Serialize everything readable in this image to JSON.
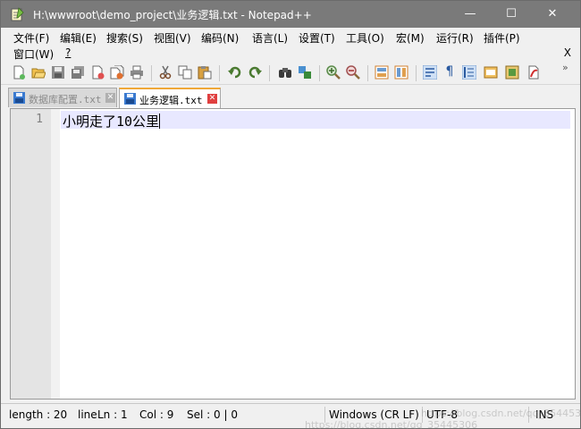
{
  "window": {
    "title": "H:\\wwwroot\\demo_project\\业务逻辑.txt - Notepad++",
    "minimize": "—",
    "maximize": "☐",
    "close": "✕"
  },
  "menu": {
    "items": [
      "文件(F)",
      "编辑(E)",
      "搜索(S)",
      "视图(V)",
      "编码(N)",
      "语言(L)",
      "设置(T)",
      "工具(O)",
      "宏(M)",
      "运行(R)",
      "插件(P)"
    ],
    "row2": [
      "窗口(W)",
      "?"
    ],
    "close_doc": "X"
  },
  "toolbar": {
    "icons": [
      "new-file-icon",
      "open-file-icon",
      "save-icon",
      "save-all-icon",
      "close-icon",
      "close-all-icon",
      "print-icon",
      "cut-icon",
      "copy-icon",
      "paste-icon",
      "undo-icon",
      "redo-icon",
      "find-icon",
      "replace-icon",
      "zoom-in-icon",
      "zoom-out-icon",
      "sync-vertical-icon",
      "sync-horizontal-icon",
      "word-wrap-icon",
      "show-all-chars-icon",
      "indent-guide-icon",
      "doc-map-icon",
      "function-list-icon",
      "folder-workspace-icon"
    ],
    "overflow": "»"
  },
  "tabs": [
    {
      "label": "数据库配置.txt",
      "active": false,
      "close": "✕"
    },
    {
      "label": "业务逻辑.txt",
      "active": true,
      "close": "✕"
    }
  ],
  "editor": {
    "line_number": "1",
    "text": "小明走了10公里"
  },
  "status": {
    "length": "length : 20",
    "lines": "line",
    "ln": "Ln : 1",
    "col": "Col : 9",
    "sel": "Sel : 0 | 0",
    "eol": "Windows (CR LF)",
    "encoding": "UTF-8",
    "mode": "INS"
  },
  "watermark": {
    "line1": "https://blog.csdn.net/qq_35445306",
    "line2": "https://blog.csdn.net/qq_35445306"
  },
  "colors": {
    "titlebar": "#7a7a7a",
    "active_tab_accent": "#f0a838",
    "current_line": "#e8e8ff"
  }
}
